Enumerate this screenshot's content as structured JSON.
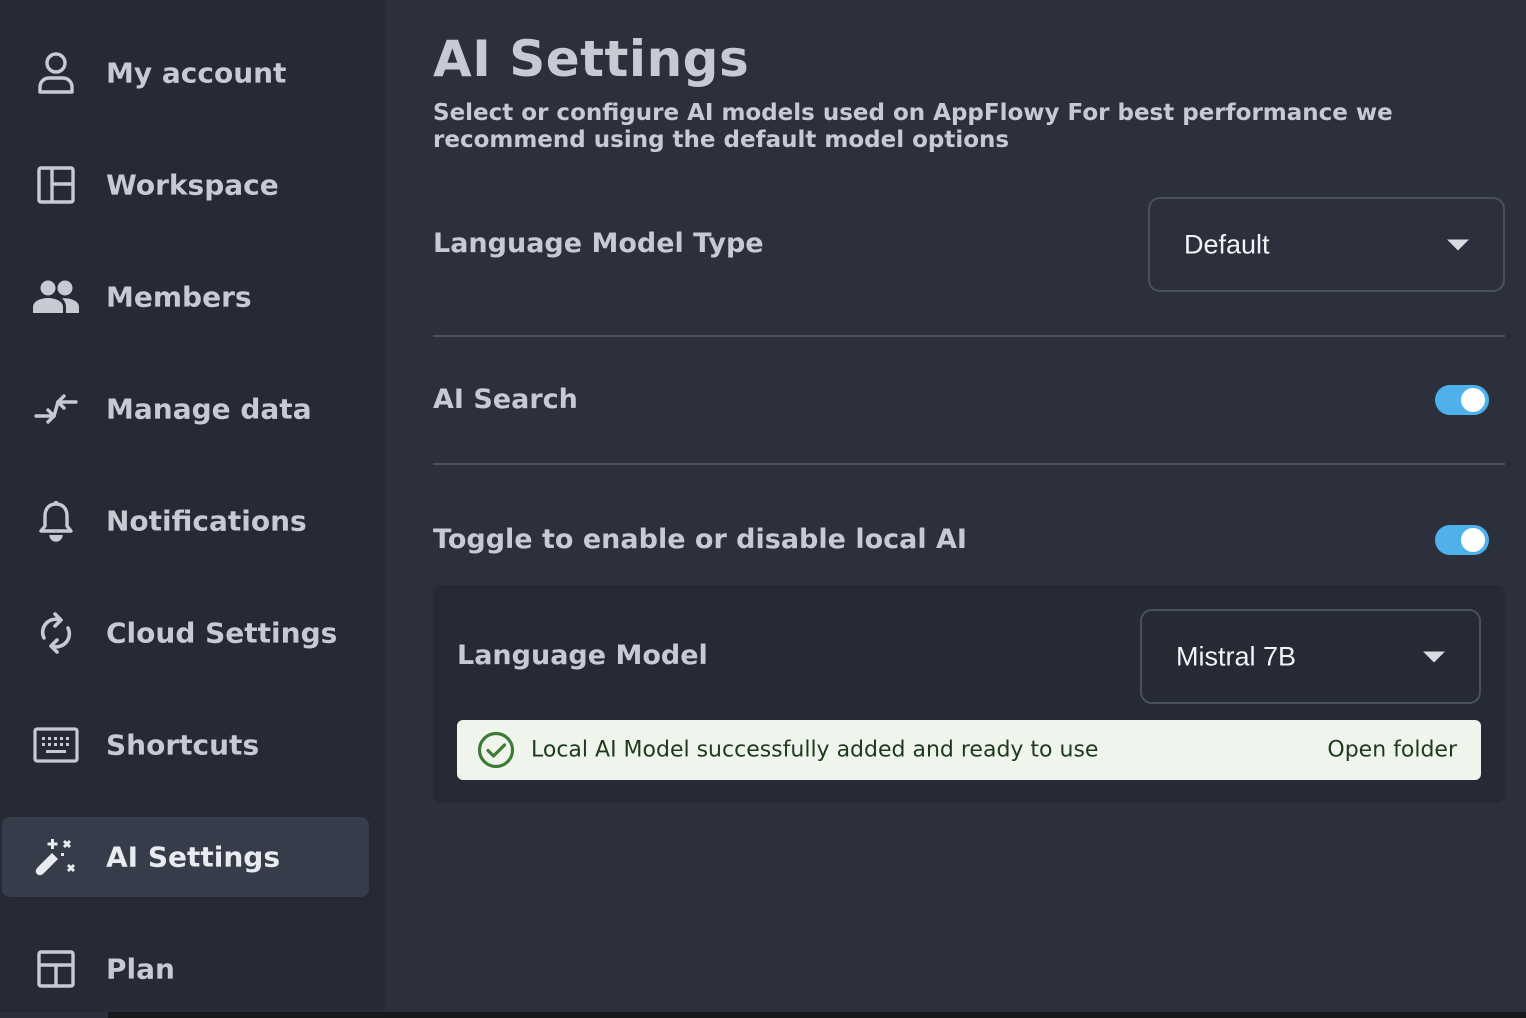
{
  "sidebar": {
    "items": [
      {
        "label": "My account",
        "icon": "user-icon"
      },
      {
        "label": "Workspace",
        "icon": "workspace-layout-icon"
      },
      {
        "label": "Members",
        "icon": "members-icon"
      },
      {
        "label": "Manage data",
        "icon": "arrows-merge-icon"
      },
      {
        "label": "Notifications",
        "icon": "bell-icon"
      },
      {
        "label": "Cloud Settings",
        "icon": "sync-icon"
      },
      {
        "label": "Shortcuts",
        "icon": "keyboard-icon"
      },
      {
        "label": "AI Settings",
        "icon": "magic-wand-icon",
        "active": true
      },
      {
        "label": "Plan",
        "icon": "plan-layout-icon"
      }
    ]
  },
  "main": {
    "title": "AI Settings",
    "description": "Select or configure AI models used on AppFlowy For best performance we recommend using the default model options",
    "model_type": {
      "label": "Language Model Type",
      "value": "Default"
    },
    "ai_search": {
      "label": "AI Search",
      "enabled": true
    },
    "local_ai": {
      "label": "Toggle to enable or disable local AI",
      "enabled": true,
      "language_model": {
        "label": "Language Model",
        "value": "Mistral 7B"
      },
      "status": {
        "message": "Local AI Model successfully added and ready to use",
        "action": "Open folder"
      }
    }
  },
  "colors": {
    "background": "#2b303c",
    "sidebar": "#252a35",
    "accent": "#4fb1ea",
    "success_bg": "#eff5ed",
    "success_icon": "#3d7a34"
  }
}
